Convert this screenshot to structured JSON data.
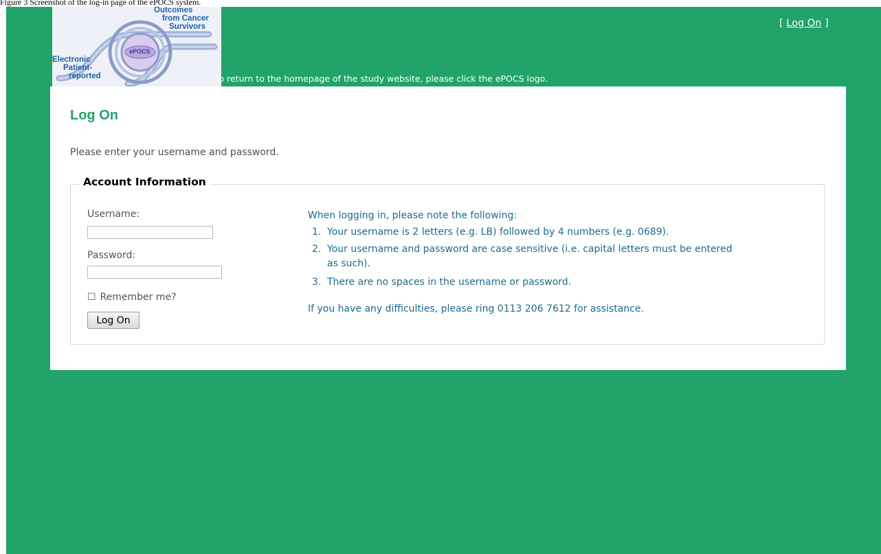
{
  "caption": "Figure 3 Screenshot of the log-in page of the ePOCS system.",
  "header": {
    "logo": {
      "alt": "ePOCS logo",
      "lines_top": [
        "Outcomes",
        "from Cancer",
        "Survivors"
      ],
      "center_badge": "ePOCS",
      "lines_bottom": [
        "Electronic",
        "Patient-",
        "reported"
      ]
    },
    "tagline": "To return to the homepage of the study website, please click the ePOCS logo.",
    "login_link": {
      "open_bracket": "[",
      "label": "Log On",
      "close_bracket": "]"
    }
  },
  "main": {
    "title": "Log On",
    "intro": "Please enter your username and password.",
    "account": {
      "legend": "Account Information",
      "username_label": "Username:",
      "username_value": "",
      "password_label": "Password:",
      "password_value": "",
      "remember_checkbox": "☐",
      "remember_label": "Remember me?",
      "remember_checked": false,
      "submit_label": "Log On"
    },
    "notes": {
      "heading": "When logging in, please note the following:",
      "items": [
        {
          "number": "1.",
          "text": "Your username is 2 letters (e.g. LB) followed by 4 numbers (e.g. 0689)."
        },
        {
          "number": "2.",
          "text": "Your username and password are case sensitive (i.e. capital letters must be entered",
          "text_cont": "as such)."
        },
        {
          "number": "3.",
          "text": "There are no spaces in the username or password."
        }
      ],
      "footer": "If you have any difficulties, please ring 0113 206 7612 for assistance."
    }
  },
  "colors": {
    "background": "#22a36a",
    "panel": "#ffffff",
    "title": "#22a36a",
    "notes_text": "#1d6a8f",
    "logo_text": "#1f5fa8"
  }
}
